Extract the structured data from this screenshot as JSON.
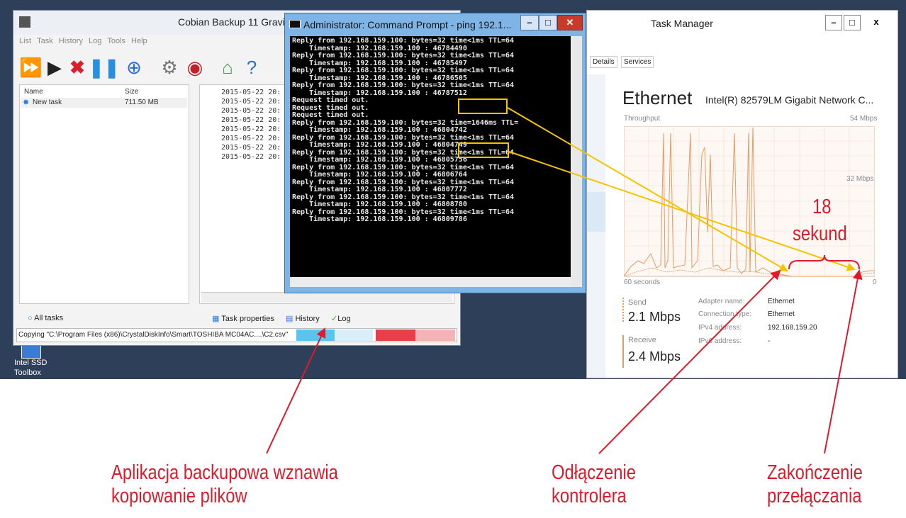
{
  "cobian": {
    "title": "Cobian Backup 11 Gravi",
    "menu": [
      "List",
      "Task",
      "History",
      "Log",
      "Tools",
      "Help"
    ],
    "col_name": "Name",
    "col_size": "Size",
    "task_name": "New task",
    "task_size": "711.50 MB",
    "log_lines": [
      "2015-05-22 20:",
      "2015-05-22 20:",
      "2015-05-22 20:",
      "2015-05-22 20:",
      "2015-05-22 20:",
      "2015-05-22 20:",
      "2015-05-22 20:",
      "2015-05-22 20:"
    ],
    "tab_all": "All tasks",
    "tab_props": "Task properties",
    "tab_history": "History",
    "tab_log": "Log",
    "status": "Copying \"C:\\Program Files (x86)\\CrystalDiskInfo\\Smart\\TOSHIBA MC04AC....\\C2.csv\"",
    "progress_1": 0.5,
    "progress_2": 0.5
  },
  "desktop": {
    "icon_label_1": "Intel SSD",
    "icon_label_2": "Toolbox"
  },
  "cmd": {
    "title": "Administrator: Command Prompt - ping  192.1...",
    "lines": [
      "Reply from 192.168.159.100: bytes=32 time<1ms TTL=64",
      "    Timestamp: 192.168.159.100 : 46784490",
      "Reply from 192.168.159.100: bytes=32 time<1ms TTL=64",
      "    Timestamp: 192.168.159.100 : 46785497",
      "Reply from 192.168.159.100: bytes=32 time<1ms TTL=64",
      "    Timestamp: 192.168.159.100 : 46786505",
      "Reply from 192.168.159.100: bytes=32 time<1ms TTL=64",
      "    Timestamp: 192.168.159.100 : 46787512",
      "Request timed out.",
      "Request timed out.",
      "Request timed out.",
      "Reply from 192.168.159.100: bytes=32 time=1646ms TTL=",
      "    Timestamp: 192.168.159.100 : 46804742",
      "Reply from 192.168.159.100: bytes=32 time<1ms TTL=64",
      "    Timestamp: 192.168.159.100 : 46804749",
      "Reply from 192.168.159.100: bytes=32 time<1ms TTL=64",
      "    Timestamp: 192.168.159.100 : 46805756",
      "Reply from 192.168.159.100: bytes=32 time<1ms TTL=64",
      "    Timestamp: 192.168.159.100 : 46806764",
      "Reply from 192.168.159.100: bytes=32 time<1ms TTL=64",
      "    Timestamp: 192.168.159.100 : 46807772",
      "Reply from 192.168.159.100: bytes=32 time<1ms TTL=64",
      "    Timestamp: 192.168.159.100 : 46808780",
      "Reply from 192.168.159.100: bytes=32 time<1ms TTL=64",
      "    Timestamp: 192.168.159.100 : 46809786"
    ]
  },
  "taskmanager": {
    "title": "Task Manager",
    "tabs": [
      "Details",
      "Services"
    ],
    "heading": "Ethernet",
    "adapter_desc": "Intel(R) 82579LM Gigabit Network C...",
    "throughput_label": "Throughput",
    "max_label": "54 Mbps",
    "mid_label": "32 Mbps",
    "time_label": "60 seconds",
    "zero_label": "0",
    "send_label": "Send",
    "send_value": "2.1 Mbps",
    "receive_label": "Receive",
    "receive_value": "2.4 Mbps",
    "kv": [
      {
        "k": "Adapter name:",
        "v": "Ethernet"
      },
      {
        "k": "Connection type:",
        "v": "Ethernet"
      },
      {
        "k": "IPv4 address:",
        "v": "192.168.159.20"
      },
      {
        "k": "IPv6 address:",
        "v": "-"
      }
    ]
  },
  "annotations": {
    "gap_num": "18",
    "gap_unit": "sekund",
    "backup_1": "Aplikacja backupowa wznawia",
    "backup_2": "kopiowanie plików",
    "disconnect_1": "Odłączenie",
    "disconnect_2": "kontrolera",
    "switch_1": "Zakończenie",
    "switch_2": "przełączania"
  },
  "colors": {
    "arrow_red": "#e01a2a",
    "arrow_yellow": "#f5c400",
    "graph_line": "#e89a60",
    "progress_blue": "#5bc4ea",
    "progress_red": "#e8404a"
  }
}
